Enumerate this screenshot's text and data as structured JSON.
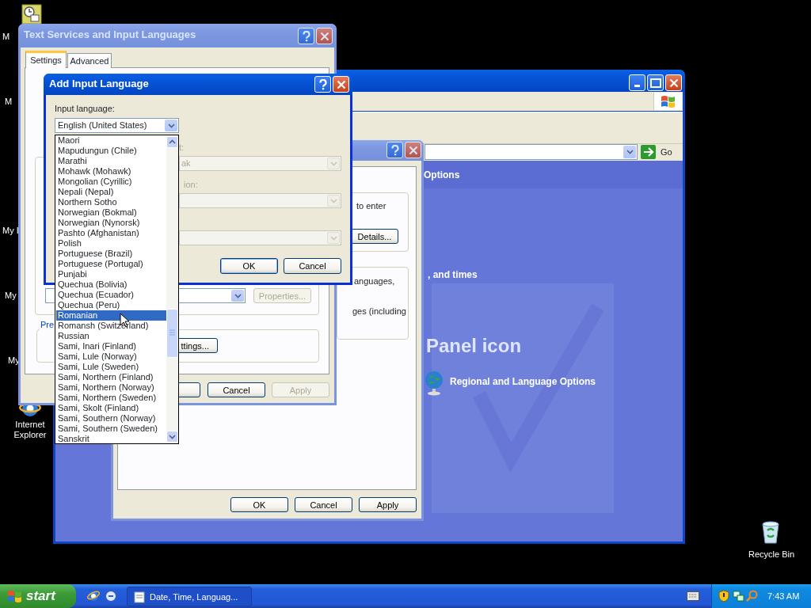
{
  "desktop": {
    "partial_labels": [
      "M",
      "M",
      "My I",
      "My",
      "My"
    ],
    "icons": [
      {
        "label": "Internet Explorer"
      },
      {
        "label": "Recycle Bin"
      }
    ]
  },
  "control_panel": {
    "go_label": "Go",
    "header_fragment": "Options",
    "text_fragment": ", and times",
    "heading_fragment": "Panel icon",
    "link": "Regional and Language Options"
  },
  "regional_dialog": {
    "text_fragments": [
      "to enter",
      "anguages,",
      "ges (including"
    ],
    "details_button": "Details...",
    "buttons": [
      {
        "label": "OK",
        "disabled": false
      },
      {
        "label": "Cancel",
        "disabled": false
      },
      {
        "label": "Apply",
        "disabled": false
      }
    ]
  },
  "text_services": {
    "title": "Text Services and Input Languages",
    "tabs": [
      {
        "label": "Settings",
        "selected": true
      },
      {
        "label": "Advanced",
        "selected": false
      }
    ],
    "properties_button": {
      "label": "Properties...",
      "disabled": true
    },
    "group_fragment": "Pre",
    "settings_button": "ttings...",
    "buttons": [
      {
        "label": "Cancel",
        "disabled": false
      },
      {
        "label": "Apply",
        "disabled": true
      }
    ]
  },
  "add_input_language": {
    "title": "Add Input Language",
    "label": "Input language:",
    "value": "English (United States)",
    "label_fragments": [
      "t:",
      "ion:"
    ],
    "keyboard_value_fragment": "ak",
    "buttons": [
      {
        "label": "OK",
        "default": true
      },
      {
        "label": "Cancel",
        "default": false
      }
    ],
    "options": [
      {
        "label": "Maori",
        "selected": false
      },
      {
        "label": "Mapudungun (Chile)",
        "selected": false
      },
      {
        "label": "Marathi",
        "selected": false
      },
      {
        "label": "Mohawk (Mohawk)",
        "selected": false
      },
      {
        "label": "Mongolian (Cyrillic)",
        "selected": false
      },
      {
        "label": "Nepali (Nepal)",
        "selected": false
      },
      {
        "label": "Northern Sotho",
        "selected": false
      },
      {
        "label": "Norwegian (Bokmal)",
        "selected": false
      },
      {
        "label": "Norwegian (Nynorsk)",
        "selected": false
      },
      {
        "label": "Pashto (Afghanistan)",
        "selected": false
      },
      {
        "label": "Polish",
        "selected": false
      },
      {
        "label": "Portuguese (Brazil)",
        "selected": false
      },
      {
        "label": "Portuguese (Portugal)",
        "selected": false
      },
      {
        "label": "Punjabi",
        "selected": false
      },
      {
        "label": "Quechua (Bolivia)",
        "selected": false
      },
      {
        "label": "Quechua (Ecuador)",
        "selected": false
      },
      {
        "label": "Quechua (Peru)",
        "selected": false
      },
      {
        "label": "Romanian",
        "selected": true
      },
      {
        "label": "Romansh (Switzerland)",
        "selected": false
      },
      {
        "label": "Russian",
        "selected": false
      },
      {
        "label": "Sami, Inari (Finland)",
        "selected": false
      },
      {
        "label": "Sami, Lule (Norway)",
        "selected": false
      },
      {
        "label": "Sami, Lule (Sweden)",
        "selected": false
      },
      {
        "label": "Sami, Northern (Finland)",
        "selected": false
      },
      {
        "label": "Sami, Northern (Norway)",
        "selected": false
      },
      {
        "label": "Sami, Northern (Sweden)",
        "selected": false
      },
      {
        "label": "Sami, Skolt (Finland)",
        "selected": false
      },
      {
        "label": "Sami, Southern (Norway)",
        "selected": false
      },
      {
        "label": "Sami, Southern (Sweden)",
        "selected": false
      },
      {
        "label": "Sanskrit",
        "selected": false
      }
    ]
  },
  "taskbar": {
    "start": "start",
    "task": "Date, Time, Languag...",
    "clock": "7:43 AM"
  }
}
